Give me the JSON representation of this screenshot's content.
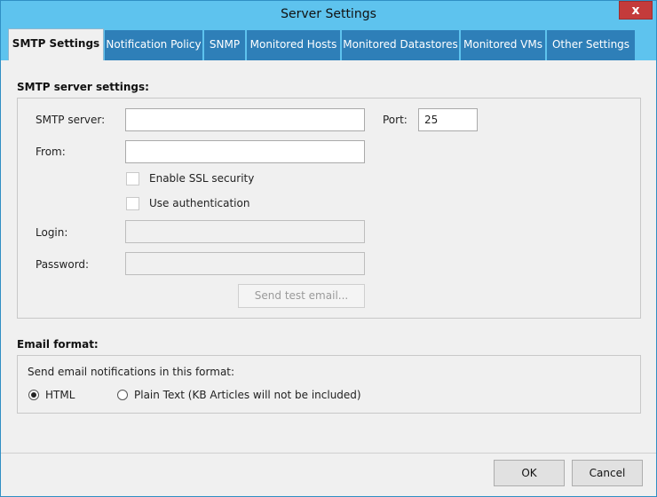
{
  "window": {
    "title": "Server Settings",
    "close_glyph": "x"
  },
  "tabs": [
    {
      "label": "SMTP Settings"
    },
    {
      "label": "Notification Policy"
    },
    {
      "label": "SNMP"
    },
    {
      "label": "Monitored Hosts"
    },
    {
      "label": "Monitored Datastores"
    },
    {
      "label": "Monitored VMs"
    },
    {
      "label": "Other Settings"
    }
  ],
  "smtp": {
    "section_title": "SMTP server settings:",
    "server_label": "SMTP server:",
    "server_value": "",
    "port_label": "Port:",
    "port_value": "25",
    "from_label": "From:",
    "from_value": "",
    "ssl_label": "Enable SSL security",
    "ssl_checked": false,
    "auth_label": "Use authentication",
    "auth_checked": false,
    "login_label": "Login:",
    "login_value": "",
    "password_label": "Password:",
    "password_value": "",
    "test_button": "Send test email..."
  },
  "email_format": {
    "section_title": "Email format:",
    "prompt": "Send email notifications in this format:",
    "options": [
      {
        "label": "HTML",
        "selected": true
      },
      {
        "label": "Plain Text (KB Articles will not be included)",
        "selected": false
      }
    ]
  },
  "footer": {
    "ok_label": "OK",
    "cancel_label": "Cancel"
  },
  "colors": {
    "titlebar": "#5ec3ee",
    "tab_inactive": "#2e7fb8",
    "close": "#c43b3b"
  }
}
